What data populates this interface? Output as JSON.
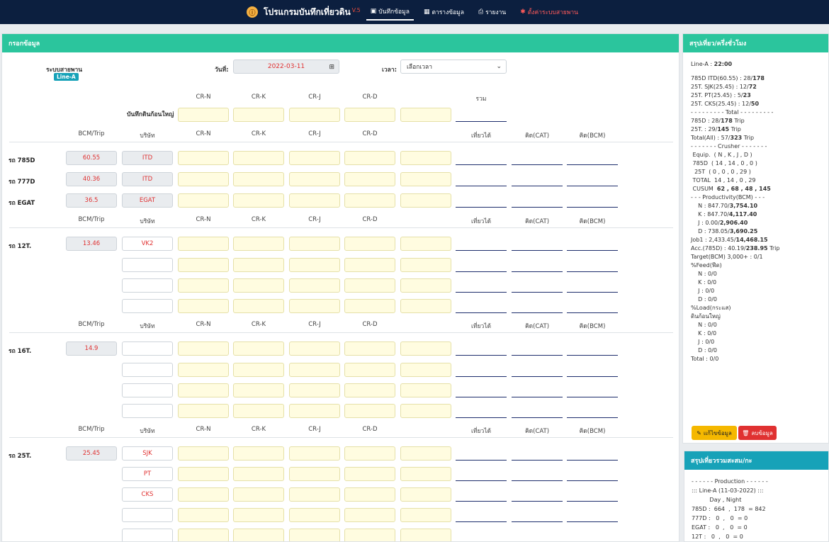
{
  "topbar": {
    "logo_text": "ⓘ",
    "title": "โปรแกรมบันทึกเที่ยวดิน",
    "version": "V.5",
    "nav": [
      {
        "label": "บันทึกข้อมูล",
        "icon": "save-icon",
        "glyph": "▣"
      },
      {
        "label": "ตารางข้อมูล",
        "icon": "table-icon",
        "glyph": "▦"
      },
      {
        "label": "รายงาน",
        "icon": "print-icon",
        "glyph": "⎙"
      },
      {
        "label": "ตั้งค่าระบบสายพาน",
        "icon": "gears-icon",
        "glyph": "✱"
      }
    ]
  },
  "form": {
    "header": "กรอกข้อมูล",
    "belt_label": "ระบบสายพาน",
    "belt_badge": "Line-A",
    "date_label": "วันที่:",
    "date_value": "2022-03-11",
    "date_icon": "⊞",
    "time_label": "เวลา:",
    "time_placeholder": "เลือกเวลา",
    "time_chevron": "⌄",
    "big_rock_label": "บันทึกดินก้อนใหญ่",
    "top_cols": [
      "CR-N",
      "CR-K",
      "CR-J",
      "CR-D",
      "รวม"
    ],
    "cols": {
      "bcm": "BCM/Trip",
      "company": "บริษัท",
      "crn": "CR-N",
      "crk": "CR-K",
      "crj": "CR-J",
      "crd": "CR-D",
      "trips": "เที่ยวได้",
      "cat": "คิด(CAT)",
      "bcmcalc": "คิด(BCM)"
    },
    "trucks": {
      "t785": {
        "label": "รถ 785D",
        "bcm": "60.55",
        "company": "ITD"
      },
      "t777": {
        "label": "รถ 777D",
        "bcm": "40.36",
        "company": "ITD"
      },
      "tegat": {
        "label": "รถ EGAT",
        "bcm": "36.5",
        "company": "EGAT"
      },
      "t12": {
        "label": "รถ 12T.",
        "bcm": "13.46",
        "company": "VK2"
      },
      "t16": {
        "label": "รถ 16T.",
        "bcm": "14.9"
      },
      "t25": {
        "label": "รถ 25T.",
        "bcm": "25.45",
        "companies": [
          "SJK",
          "PT",
          "CKS"
        ]
      }
    }
  },
  "summary": {
    "header": "สรุปเที่ยว/ครึ่งชั่วโมง",
    "line_label": "Line-A : ",
    "line_time": "22:00",
    "rows": [
      {
        "a": "785D ITD(60.55) : 28/",
        "b": "178"
      },
      {
        "a": "25T. SJK(25.45) : 12/",
        "b": "72"
      },
      {
        "a": "25T. PT(25.45) : 5/",
        "b": "23"
      },
      {
        "a": "25T. CKS(25.45) : 12/",
        "b": "50"
      },
      {
        "a": "- - - - - - - - - Total - - - - - - - - -",
        "b": ""
      },
      {
        "a": "785D : 28/",
        "b": "178",
        "c": " Trip"
      },
      {
        "a": "25T. : 29/",
        "b": "145",
        "c": " Trip"
      },
      {
        "a": "Total(All) : 57/",
        "b": "323",
        "c": " Trip"
      },
      {
        "a": "- - - - - - - Crusher - - - - - - -",
        "b": ""
      },
      {
        "a": " Equip.  ( N , K , J , D )",
        "b": ""
      },
      {
        "a": " 785D  ( 14 , 14 , 0 , 0 )",
        "b": ""
      },
      {
        "a": "  25T  ( 0 , 0 , 0 , 29 )",
        "b": ""
      },
      {
        "a": " TOTAL  14 , 14 , 0 , 29",
        "b": ""
      },
      {
        "a": " CUSUM  ",
        "b": "62 , 68 , 48 , 145"
      },
      {
        "a": "- - - Productivity(BCM) - - -",
        "b": ""
      },
      {
        "a": "    N : 847.70/",
        "b": "3,754.10"
      },
      {
        "a": "    K : 847.70/",
        "b": "4,117.40"
      },
      {
        "a": "    J : 0.00/",
        "b": "2,906.40"
      },
      {
        "a": "    D : 738.05/",
        "b": "3,690.25"
      },
      {
        "a": "",
        "b": ""
      },
      {
        "a": "",
        "b": ""
      },
      {
        "a": "Job1 : 2,433.45/",
        "b": "14,468.15"
      },
      {
        "a": "Acc.(785D) : 40.19/",
        "b": "238.95",
        "c": " Trip"
      },
      {
        "a": "",
        "b": ""
      },
      {
        "a": "",
        "b": ""
      },
      {
        "a": "Target(BCM) 3,000+ : 0/1",
        "b": ""
      },
      {
        "a": "%Feed(ฟีด)",
        "b": ""
      },
      {
        "a": "    N : 0/0",
        "b": ""
      },
      {
        "a": "    K : 0/0",
        "b": ""
      },
      {
        "a": "    J : 0/0",
        "b": ""
      },
      {
        "a": "    D : 0/0",
        "b": ""
      },
      {
        "a": "%Load(กระแส)",
        "b": ""
      },
      {
        "a": "",
        "b": ""
      },
      {
        "a": "ดินก้อนใหญ่",
        "b": ""
      },
      {
        "a": "    N : 0/0",
        "b": ""
      },
      {
        "a": "    K : 0/0",
        "b": ""
      },
      {
        "a": "    J : 0/0",
        "b": ""
      },
      {
        "a": "    D : 0/0",
        "b": ""
      },
      {
        "a": "Total : 0/0",
        "b": ""
      }
    ],
    "edit_button": "แก้ไขข้อมูล",
    "edit_glyph": "✎",
    "delete_button": "ลบข้อมูล",
    "delete_glyph": "🗑"
  },
  "summary2": {
    "header": "สรุปเที่ยวรวมสะสม/กะ",
    "lines": [
      "- - - - - - Production - - - - - -",
      "::: Line-A (11-03-2022) :::",
      "          Day , Night",
      "785D :  664  ,  178  = 842",
      "777D :   0  ,   0  = 0",
      "EGAT :   0  ,   0  = 0",
      "12T :   0  ,   0  = 0"
    ]
  }
}
